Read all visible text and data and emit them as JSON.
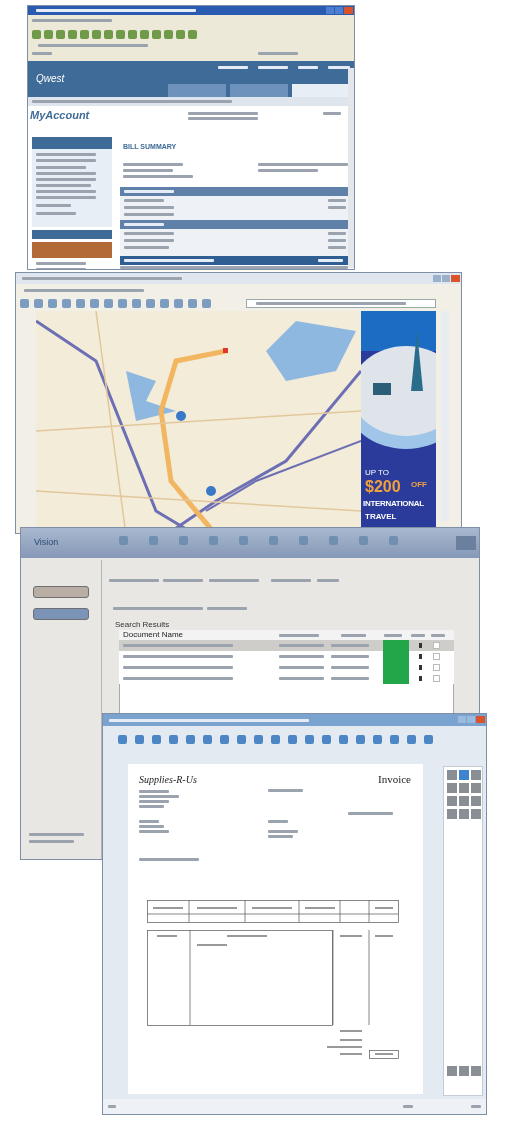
{
  "account_window": {
    "logo": "Qwest",
    "page_title": "MyAccount",
    "heading": "BILL SUMMARY",
    "nav_tabs": [
      {
        "selected": false
      },
      {
        "selected": false
      },
      {
        "selected": true
      }
    ],
    "section_bars": [
      {
        "kind": "section"
      },
      {
        "kind": "section"
      },
      {
        "kind": "total"
      }
    ]
  },
  "map_window": {
    "ad": {
      "lead": "UP TO",
      "amount": "$200",
      "suffix": "OFF",
      "line": "INTERNATIONAL",
      "cut_line": "TRAVEL"
    }
  },
  "vision_window": {
    "logo": "Vision",
    "panel_buttons": [
      {
        "selected": true
      },
      {
        "selected": false
      }
    ],
    "group_label": "Search Results",
    "first_column": "Document Name",
    "rows": [
      {
        "selected": true,
        "checked": false
      },
      {
        "selected": false,
        "checked": false
      },
      {
        "selected": false,
        "checked": false
      },
      {
        "selected": false,
        "checked": false
      }
    ]
  },
  "invoice_window": {
    "company": "Supplies-R-Us",
    "doc_title": "Invoice"
  }
}
